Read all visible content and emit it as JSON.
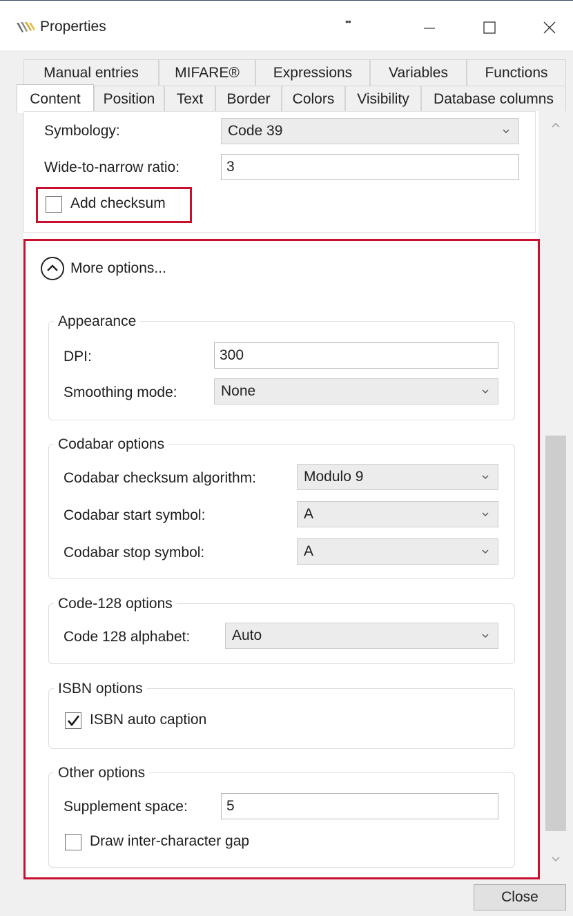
{
  "window": {
    "title": "Properties",
    "title_dots": "••"
  },
  "tabs_row1": [
    "Manual entries",
    "MIFARE®",
    "Expressions",
    "Variables",
    "Functions"
  ],
  "tabs_row2": [
    "Content",
    "Position",
    "Text",
    "Border",
    "Colors",
    "Visibility",
    "Database columns"
  ],
  "barcode": {
    "symbology_label": "Symbology:",
    "symbology_value": "Code 39",
    "ratio_label": "Wide-to-narrow ratio:",
    "ratio_value": "3",
    "checksum_label": "Add checksum",
    "checksum_checked": false
  },
  "more_options": {
    "label": "More options..."
  },
  "appearance": {
    "title": "Appearance",
    "dpi_label": "DPI:",
    "dpi_value": "300",
    "smoothing_label": "Smoothing mode:",
    "smoothing_value": "None"
  },
  "codabar": {
    "title": "Codabar options",
    "checksum_algo_label": "Codabar checksum algorithm:",
    "checksum_algo_value": "Modulo 9",
    "start_label": "Codabar start symbol:",
    "start_value": "A",
    "stop_label": "Codabar stop symbol:",
    "stop_value": "A"
  },
  "code128": {
    "title": "Code-128 options",
    "alphabet_label": "Code 128 alphabet:",
    "alphabet_value": "Auto"
  },
  "isbn": {
    "title": "ISBN options",
    "auto_caption_label": "ISBN auto caption",
    "auto_caption_checked": true
  },
  "other": {
    "title": "Other options",
    "supplement_label": "Supplement space:",
    "supplement_value": "5",
    "gap_label": "Draw inter-character gap",
    "gap_checked": false
  },
  "buttons": {
    "close": "Close"
  },
  "colors": {
    "highlight": "#c8102e"
  }
}
